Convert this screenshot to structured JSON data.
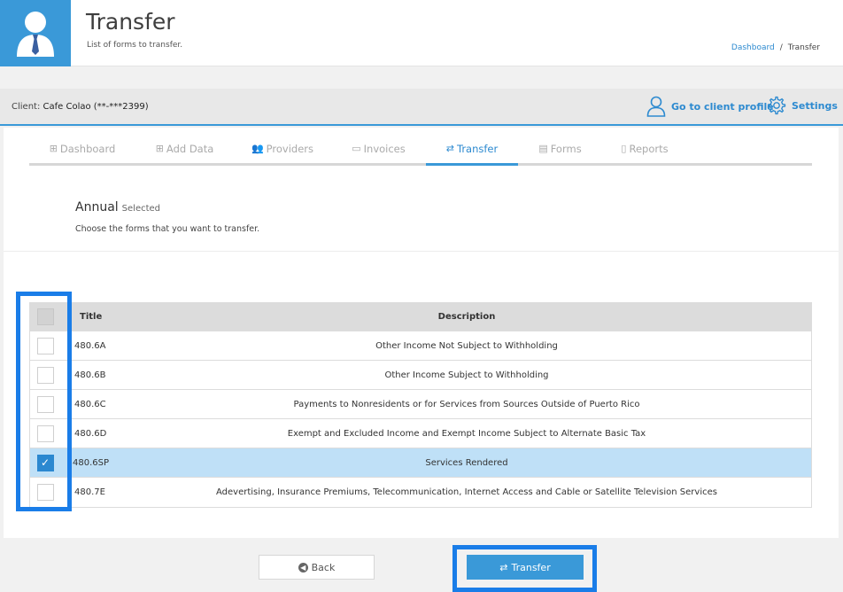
{
  "header": {
    "title": "Transfer",
    "subtitle": "List of forms to transfer.",
    "breadcrumb": {
      "home": "Dashboard",
      "separator": "/",
      "current": "Transfer"
    }
  },
  "client": {
    "label": "Client:",
    "name": "Cafe Colao (**-***2399)",
    "profile_link": "Go to client profile",
    "settings_link": "Settings"
  },
  "tabs": [
    {
      "label": "Dashboard",
      "icon": "grid-icon",
      "active": false
    },
    {
      "label": "Add Data",
      "icon": "plus-square-icon",
      "active": false
    },
    {
      "label": "Providers",
      "icon": "users-icon",
      "active": false
    },
    {
      "label": "Invoices",
      "icon": "id-card-icon",
      "active": false
    },
    {
      "label": "Transfer",
      "icon": "transfer-icon",
      "active": true
    },
    {
      "label": "Forms",
      "icon": "document-icon",
      "active": false
    },
    {
      "label": "Reports",
      "icon": "clipboard-icon",
      "active": false
    }
  ],
  "section": {
    "title": "Annual",
    "selected_label": "Selected",
    "hint": "Choose the forms that you want to transfer."
  },
  "table": {
    "headers": {
      "title": "Title",
      "description": "Description"
    },
    "rows": [
      {
        "title": "480.6A",
        "description": "Other Income Not Subject to Withholding",
        "checked": false
      },
      {
        "title": "480.6B",
        "description": "Other Income Subject to Withholding",
        "checked": false
      },
      {
        "title": "480.6C",
        "description": "Payments to Nonresidents or for Services from Sources Outside of Puerto Rico",
        "checked": false
      },
      {
        "title": "480.6D",
        "description": "Exempt and Excluded Income and Exempt Income Subject to Alternate Basic Tax",
        "checked": false
      },
      {
        "title": "480.6SP",
        "description": "Services Rendered",
        "checked": true
      },
      {
        "title": "480.7E",
        "description": "Adevertising, Insurance Premiums, Telecommunication, Internet Access and Cable or Satellite Television Services",
        "checked": false
      }
    ]
  },
  "buttons": {
    "back": "Back",
    "transfer": "Transfer"
  },
  "colors": {
    "accent": "#3a99d8",
    "highlight": "#1a7de8",
    "selected_row": "#bfe0f7"
  }
}
